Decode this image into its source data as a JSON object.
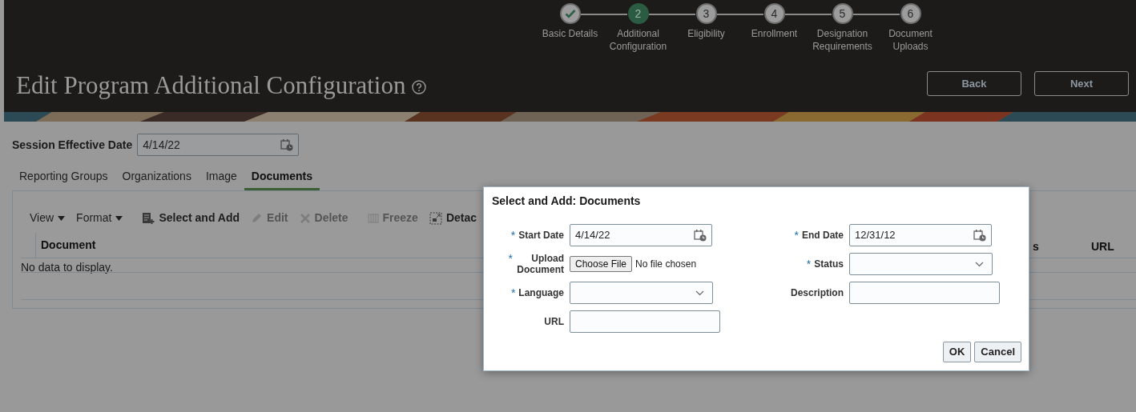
{
  "stepper": [
    {
      "label": "Basic Details",
      "completed": true,
      "selected": false
    },
    {
      "label": "Additional Configuration",
      "number": "2",
      "completed": false,
      "selected": true
    },
    {
      "label": "Eligibility",
      "number": "3",
      "completed": false,
      "selected": false
    },
    {
      "label": "Enrollment",
      "number": "4",
      "completed": false,
      "selected": false
    },
    {
      "label": "Designation Requirements",
      "number": "5",
      "completed": false,
      "selected": false
    },
    {
      "label": "Document Uploads",
      "number": "6",
      "completed": false,
      "selected": false
    }
  ],
  "page_title": "Edit Program Additional Configuration",
  "header_buttons": [
    "Back",
    "Next"
  ],
  "session_effective_date": {
    "label": "Session Effective Date",
    "value": "4/14/22"
  },
  "tabs": [
    {
      "label": "Reporting Groups",
      "selected": false
    },
    {
      "label": "Organizations",
      "selected": false
    },
    {
      "label": "Image",
      "selected": false
    },
    {
      "label": "Documents",
      "selected": true
    }
  ],
  "toolbar": [
    {
      "label": "View",
      "kind": "menu",
      "disabled": false
    },
    {
      "label": "Format",
      "kind": "menu",
      "disabled": false
    },
    {
      "label": "Select and Add",
      "kind": "add",
      "disabled": false
    },
    {
      "label": "Edit",
      "kind": "edit",
      "disabled": true
    },
    {
      "label": "Delete",
      "kind": "delete",
      "disabled": true
    },
    {
      "label": "Freeze",
      "kind": "freeze",
      "disabled": true
    },
    {
      "label": "Detac",
      "kind": "detach",
      "disabled": false
    }
  ],
  "table": {
    "columns": [
      "Document",
      "s",
      "URL"
    ],
    "empty_text": "No data to display."
  },
  "dialog": {
    "title": "Select and Add: Documents",
    "left_fields": [
      {
        "label": "Start Date",
        "kind": "date",
        "required_mark": "*",
        "value": "4/14/22"
      },
      {
        "label": "Upload Document",
        "kind": "file",
        "required_mark": "*",
        "button": "Choose File",
        "value": "No file chosen"
      },
      {
        "label": "Language",
        "kind": "select",
        "required_mark": "*"
      },
      {
        "label": "URL",
        "kind": "text"
      }
    ],
    "right_fields": [
      {
        "label": "End Date",
        "kind": "date",
        "required_mark": "*",
        "value": "12/31/12"
      },
      {
        "label": "Status",
        "kind": "select",
        "required_mark": "*"
      },
      {
        "label": "Description",
        "kind": "text"
      }
    ],
    "buttons": [
      "OK",
      "Cancel"
    ]
  }
}
